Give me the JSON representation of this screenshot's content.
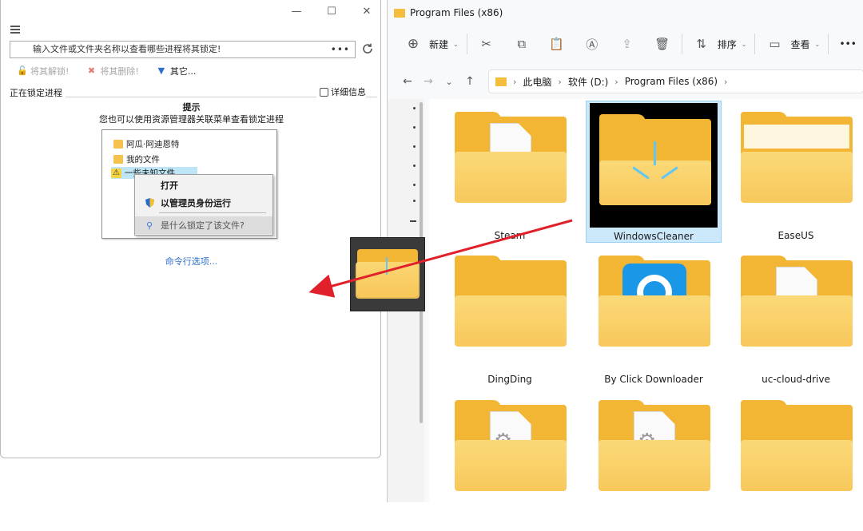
{
  "left_window": {
    "search_placeholder": "输入文件或文件夹名称以查看哪些进程将其锁定!",
    "search_more": "•••",
    "actions": {
      "unlock": "将其解锁!",
      "delete": "将其删除!",
      "other": "其它..."
    },
    "group_label": "正在锁定进程",
    "detail_label": "详细信息",
    "hint_title": "提示",
    "hint_text": "您也可以使用资源管理器关联菜单查看锁定进程",
    "preview_items": [
      "阿瓜·阿迪恩特",
      "我的文件",
      "一些未知文件..."
    ],
    "context_menu": {
      "open": "打开",
      "run_as_admin": "以管理员身份运行",
      "what_locked": "是什么锁定了该文件?"
    },
    "cmd_link": "命令行选项..."
  },
  "explorer": {
    "title": "Program Files (x86)",
    "toolbar": {
      "new": "新建",
      "sort": "排序",
      "view": "查看",
      "more": "•••"
    },
    "breadcrumb": [
      "此电脑",
      "软件 (D:)",
      "Program Files (x86)"
    ],
    "folders": [
      {
        "name": "Steam"
      },
      {
        "name": "WindowsCleaner"
      },
      {
        "name": "EaseUS"
      },
      {
        "name": "DingDing"
      },
      {
        "name": "By Click Downloader"
      },
      {
        "name": "uc-cloud-drive"
      },
      {
        "name": ""
      },
      {
        "name": ""
      },
      {
        "name": ""
      }
    ]
  },
  "colors": {
    "accent": "#2f6fc9",
    "arrow": "#e0202a",
    "folder": "#f2b534",
    "selection": "#cce8fb"
  }
}
